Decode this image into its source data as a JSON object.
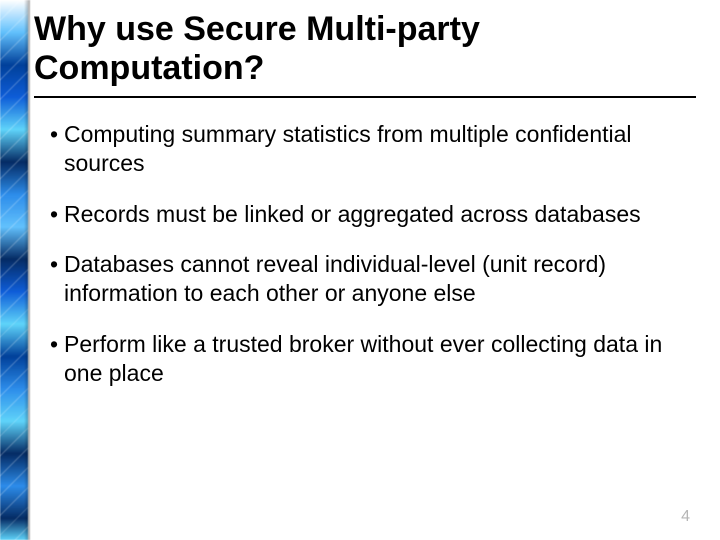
{
  "title": "Why use Secure Multi-party Computation?",
  "bullets": [
    "Computing summary statistics from multiple confidential sources",
    "Records must be linked or aggregated across databases",
    "Databases cannot reveal individual-level (unit record) information to each other or anyone else",
    "Perform like a trusted broker without ever collecting data in one place"
  ],
  "page_number": "4"
}
